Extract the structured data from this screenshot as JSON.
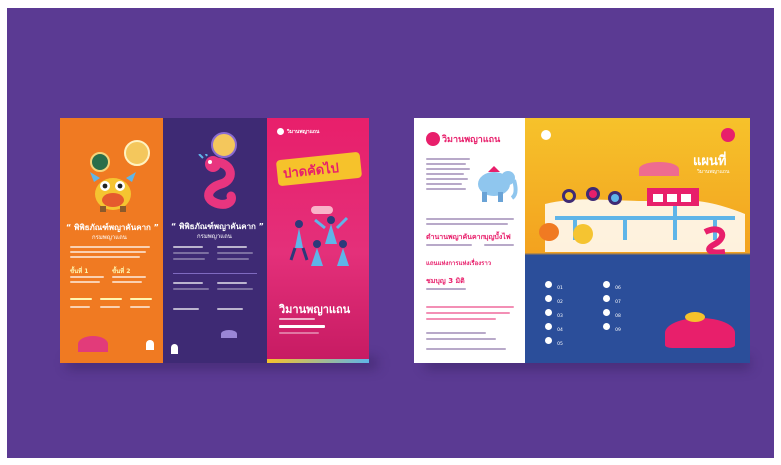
{
  "brochure_left": {
    "panel1": {
      "title": "“ พิพิธภัณฑ์พญาคันคาก ”",
      "subtitle": "กรมพญาแถน",
      "step1": "ขั้นที่ 1",
      "step2": "ขั้นที่ 2"
    },
    "panel2": {
      "title": "“ พิพิธภัณฑ์พญาคันคาก ”",
      "subtitle": "กรมพญาแถน"
    },
    "panel3": {
      "brand": "วิมานพญาแถน",
      "tagline": "ปาดคัดไป",
      "footer_title": "วิมานพญาแถน"
    }
  },
  "brochure_right": {
    "panel4": {
      "brand": "วิมานพญาแถน",
      "heading1": "ตำนานพญาคันคาก",
      "heading2": "บุญบั้งไฟ",
      "heading3": "แถนแห่งการแห่งเรื่องราว",
      "heading4": "ชมบุญ 3 มิติ"
    },
    "panel5": {
      "map_title": "แผนที่",
      "map_subtitle": "วิมานพญาแถน",
      "legend": [
        "01",
        "02",
        "03",
        "04",
        "05",
        "06",
        "07",
        "08",
        "09"
      ]
    }
  },
  "colors": {
    "background": "#5b3a93",
    "orange": "#f07a22",
    "deep_purple": "#3e2a74",
    "pink": "#e81f6b",
    "yellow": "#f6c22b",
    "blue": "#2b4e9a"
  }
}
